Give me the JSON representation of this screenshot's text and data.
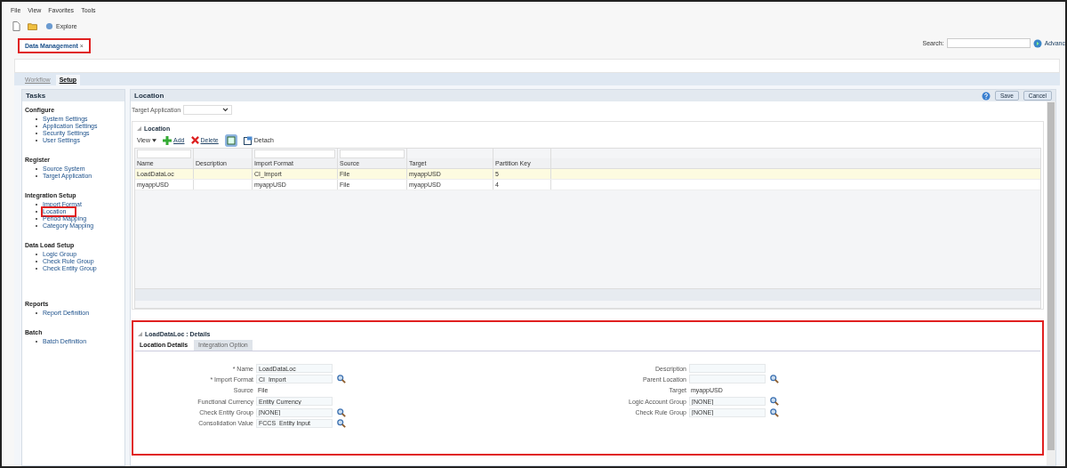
{
  "menu": [
    "File",
    "View",
    "Favorites",
    "Tools"
  ],
  "toolbar": {
    "explore": "Explore"
  },
  "doc_tab": {
    "label": "Data Management",
    "close": "×",
    "highlighted": true
  },
  "search": {
    "label": "Search:",
    "advanced": "Advanc"
  },
  "tabs": [
    {
      "label": "Workflow",
      "selected": false
    },
    {
      "label": "Setup",
      "selected": true
    }
  ],
  "tasks": {
    "title": "Tasks",
    "groups": [
      {
        "title": "Configure",
        "items": [
          {
            "label": "System Settings",
            "highlighted": false
          },
          {
            "label": "Application Settings",
            "highlighted": false
          },
          {
            "label": "Security Settings",
            "highlighted": false
          },
          {
            "label": "User Settings",
            "highlighted": false
          }
        ]
      },
      {
        "title": "Register",
        "items": [
          {
            "label": "Source System",
            "highlighted": false
          },
          {
            "label": "Target Application",
            "highlighted": false
          }
        ]
      },
      {
        "title": "Integration Setup",
        "items": [
          {
            "label": "Import Format",
            "highlighted": false
          },
          {
            "label": "Location",
            "highlighted": true
          },
          {
            "label": "Period Mapping",
            "highlighted": false
          },
          {
            "label": "Category Mapping",
            "highlighted": false
          }
        ]
      },
      {
        "title": "Data Load Setup",
        "items": [
          {
            "label": "Logic Group",
            "highlighted": false
          },
          {
            "label": "Check Rule Group",
            "highlighted": false
          },
          {
            "label": "Check Entity Group",
            "highlighted": false
          }
        ]
      },
      {
        "title": "Reports",
        "items": [
          {
            "label": "Report Definition",
            "highlighted": false
          }
        ]
      },
      {
        "title": "Batch",
        "items": [
          {
            "label": "Batch Definition",
            "highlighted": false
          }
        ]
      }
    ]
  },
  "page": {
    "title": "Location",
    "save": "Save",
    "cancel": "Cancel",
    "target_application": {
      "label": "Target Application"
    }
  },
  "grid": {
    "title": "Location",
    "view": "View",
    "add": "Add",
    "delete": "Delete",
    "detach": "Detach",
    "columns": [
      "Name",
      "Description",
      "Import Format",
      "Source",
      "Target",
      "Partition Key"
    ],
    "rows": [
      {
        "cells": [
          "LoadDataLoc",
          "",
          "CI_Import",
          "File",
          "myappUSD",
          "5"
        ],
        "selected": true
      },
      {
        "cells": [
          "myappUSD",
          "",
          "myappUSD",
          "File",
          "myappUSD",
          "4"
        ],
        "selected": false
      }
    ]
  },
  "details": {
    "title": "LoadDataLoc : Details",
    "highlighted": true,
    "tabs": [
      {
        "label": "Location Details",
        "selected": true
      },
      {
        "label": "Integration Option",
        "selected": false
      }
    ],
    "left_fields": [
      {
        "label": "* Name",
        "value": "LoadDataLoc",
        "kind": "input"
      },
      {
        "label": "* Import Format",
        "value": "CI_Import",
        "kind": "lookup"
      },
      {
        "label": "Source",
        "value": "File",
        "kind": "text"
      },
      {
        "label": "Functional Currency",
        "value": "Entity Currency",
        "kind": "input"
      },
      {
        "label": "Check Entity Group",
        "value": "[NONE]",
        "kind": "lookup"
      },
      {
        "label": "Consolidation Value",
        "value": "FCCS_Entity Input",
        "kind": "lookup"
      }
    ],
    "right_fields": [
      {
        "label": "Description",
        "kind": "input"
      },
      {
        "label": "Parent Location",
        "kind": "lookup"
      },
      {
        "label": "Target",
        "value": "myappUSD",
        "kind": "text"
      },
      {
        "label": "Logic Account Group",
        "value": "[NONE]",
        "kind": "lookup"
      },
      {
        "label": "Check Rule Group",
        "value": "[NONE]",
        "kind": "lookup"
      }
    ]
  }
}
